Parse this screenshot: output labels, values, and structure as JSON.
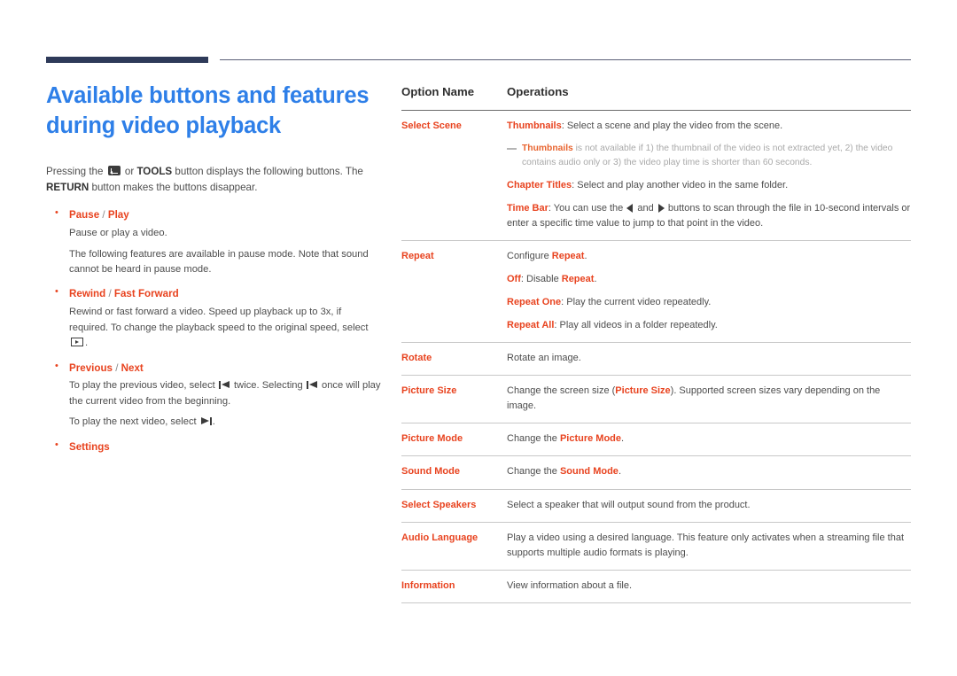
{
  "page": {
    "title": "Available buttons and features during video playback",
    "title_line1": "Available buttons and features",
    "title_line2": "during video playback",
    "accent_blue": "#2e7fe8",
    "accent_orange": "#e8431f",
    "rule_navy": "#2e3a59"
  },
  "intro": {
    "part1": "Pressing the ",
    "part2": " or ",
    "tools_label": "TOOLS",
    "part3": " button displays the following buttons. The ",
    "return_label": "RETURN",
    "part4": " button makes the buttons disappear."
  },
  "bullets": [
    {
      "head_a": "Pause",
      "head_sep": " / ",
      "head_b": "Play",
      "paras": [
        "Pause or play a video.",
        "The following features are available in pause mode. Note that sound cannot be heard in pause mode."
      ]
    },
    {
      "head_a": "Rewind",
      "head_sep": " / ",
      "head_b": "Fast Forward",
      "para_rewind_1": "Rewind or fast forward a video. Speed up playback up to 3x, if required. To change the playback speed to the original speed, select ",
      "para_rewind_2": "."
    },
    {
      "head_a": "Previous",
      "head_sep": " / ",
      "head_b": "Next",
      "para_prev_1": "To play the previous video, select ",
      "para_prev_2": " twice. Selecting ",
      "para_prev_3": " once will play the current video from the beginning.",
      "para_next_1": "To play the next video, select ",
      "para_next_2": "."
    },
    {
      "head_a": "Settings",
      "head_sep": "",
      "head_b": "",
      "paras": []
    }
  ],
  "table": {
    "headers": {
      "option_name": "Option Name",
      "operations": "Operations"
    },
    "rows": {
      "select_scene": {
        "name": "Select Scene",
        "l1_hl": "Thumbnails",
        "l1_rest": ": Select a scene and play the video from the scene.",
        "note_hl": "Thumbnails",
        "note_rest": " is not available if 1) the thumbnail of the video is not extracted yet, 2) the video contains audio only or 3) the video play time is shorter than 60 seconds.",
        "l2_hl": "Chapter Titles",
        "l2_rest": ": Select and play another video in the same folder.",
        "l3_hl": "Time Bar",
        "l3_a": ": You can use the ",
        "l3_b": " and ",
        "l3_c": " buttons to scan through the file in 10-second intervals or enter a specific time value to jump to that point in the video."
      },
      "repeat": {
        "name": "Repeat",
        "l1_a": "Configure ",
        "l1_hl": "Repeat",
        "l1_b": ".",
        "l2_hl": "Off",
        "l2_a": ": Disable ",
        "l2_hl2": "Repeat",
        "l2_b": ".",
        "l3_hl": "Repeat One",
        "l3_rest": ": Play the current video repeatedly.",
        "l4_hl": "Repeat All",
        "l4_rest": ": Play all videos in a folder repeatedly."
      },
      "rotate": {
        "name": "Rotate",
        "text": "Rotate an image."
      },
      "picture_size": {
        "name": "Picture Size",
        "a": "Change the screen size (",
        "hl": "Picture Size",
        "b": "). Supported screen sizes vary depending on the image."
      },
      "picture_mode": {
        "name": "Picture Mode",
        "a": "Change the ",
        "hl": "Picture Mode",
        "b": "."
      },
      "sound_mode": {
        "name": "Sound Mode",
        "a": "Change the ",
        "hl": "Sound Mode",
        "b": "."
      },
      "select_speakers": {
        "name": "Select Speakers",
        "text": "Select a speaker that will output sound from the product."
      },
      "audio_language": {
        "name": "Audio Language",
        "text": "Play a video using a desired language. This feature only activates when a streaming file that supports multiple audio formats is playing."
      },
      "information": {
        "name": "Information",
        "text": "View information about a file."
      }
    }
  },
  "icons": {
    "enter": "enter-key-icon",
    "play_box": "play-boxed-icon",
    "skip_prev": "skip-previous-icon",
    "skip_next": "skip-next-icon",
    "arrow_left": "arrow-left-icon",
    "arrow_right": "arrow-right-icon"
  }
}
